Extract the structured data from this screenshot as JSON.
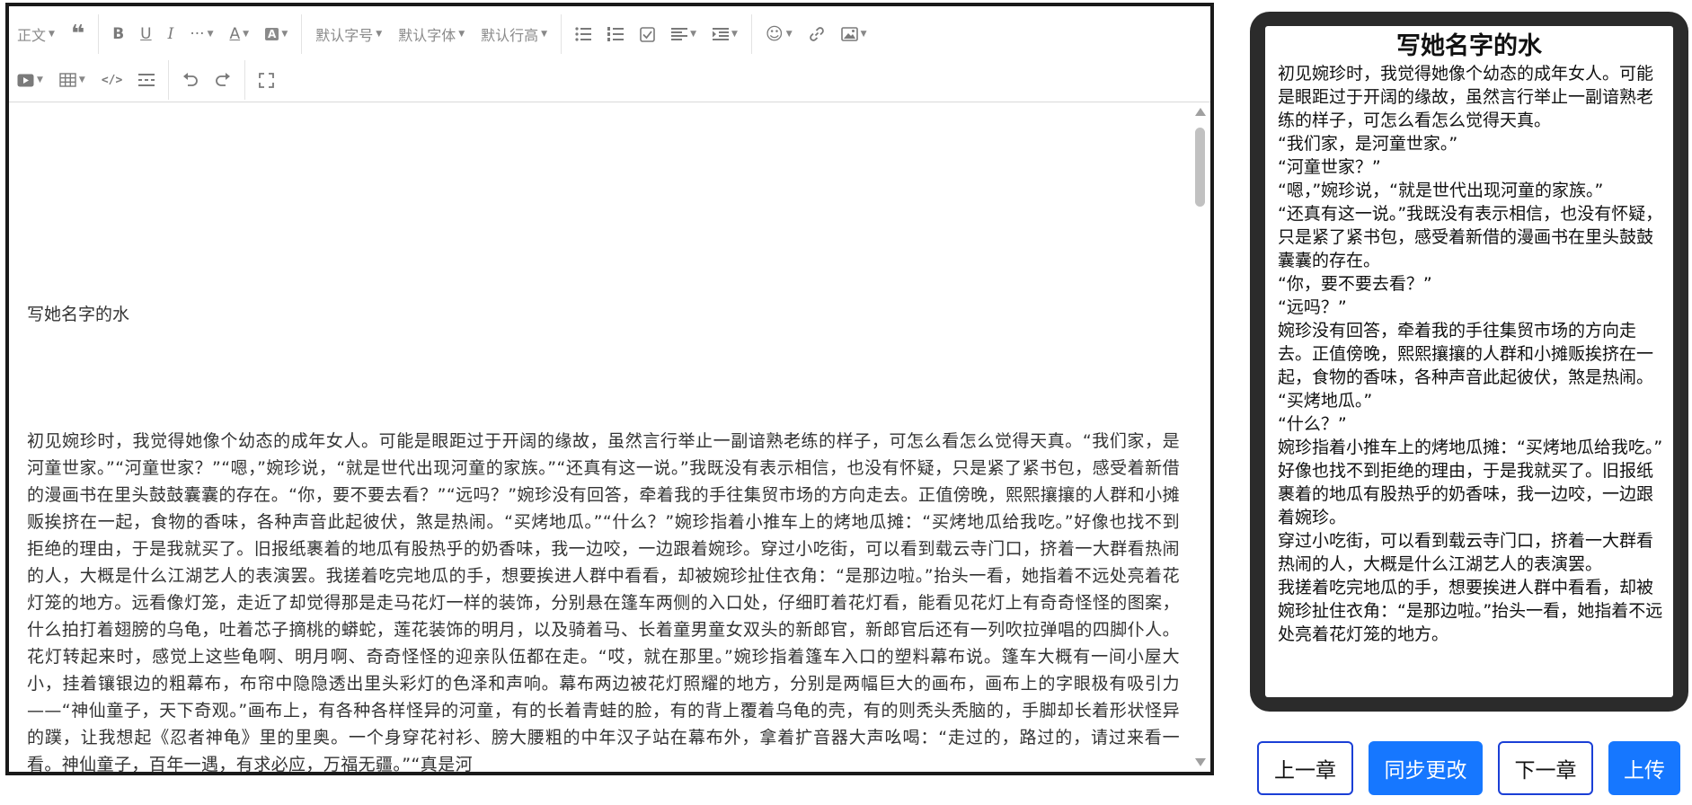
{
  "toolbar": {
    "paragraph": "正文",
    "font_size": "默认字号",
    "font_family": "默认字体",
    "line_height": "默认行高"
  },
  "doc": {
    "title": "写她名字的水",
    "body": "初见婉珍时，我觉得她像个幼态的成年女人。可能是眼距过于开阔的缘故，虽然言行举止一副谙熟老练的样子，可怎么看怎么觉得天真。“我们家，是河童世家。”“河童世家？”“嗯，”婉珍说，“就是世代出现河童的家族。”“还真有这一说。”我既没有表示相信，也没有怀疑，只是紧了紧书包，感受着新借的漫画书在里头鼓鼓囊囊的存在。“你，要不要去看？”“远吗？”婉珍没有回答，牵着我的手往集贸市场的方向走去。正值傍晚，熙熙攘攘的人群和小摊贩挨挤在一起，食物的香味，各种声音此起彼伏，煞是热闹。“买烤地瓜。”“什么？”婉珍指着小推车上的烤地瓜摊：“买烤地瓜给我吃。”好像也找不到拒绝的理由，于是我就买了。旧报纸裹着的地瓜有股热乎的奶香味，我一边咬，一边跟着婉珍。穿过小吃街，可以看到载云寺门口，挤着一大群看热闹的人，大概是什么江湖艺人的表演罢。我搓着吃完地瓜的手，想要挨进人群中看看，却被婉珍扯住衣角：“是那边啦。”抬头一看，她指着不远处亮着花灯笼的地方。远看像灯笼，走近了却觉得那是走马花灯一样的装饰，分别悬在篷车两侧的入口处，仔细盯着花灯看，能看见花灯上有奇奇怪怪的图案，什么拍打着翅膀的乌龟，吐着芯子摘桃的蟒蛇，莲花装饰的明月，以及骑着马、长着童男童女双头的新郎官，新郎官后还有一列吹拉弹唱的四脚仆人。花灯转起来时，感觉上这些龟啊、明月啊、奇奇怪怪的迎亲队伍都在走。“哎，就在那里。”婉珍指着篷车入口的塑料幕布说。篷车大概有一间小屋大小，挂着镶银边的粗幕布，布帘中隐隐透出里头彩灯的色泽和声响。幕布两边被花灯照耀的地方，分别是两幅巨大的画布，画布上的字眼极有吸引力——“神仙童子，天下奇观。”画布上，有各种各样怪异的河童，有的长着青蛙的脸，有的背上覆着乌龟的壳，有的则秃头秃脑的，手脚却长着形状怪异的蹼，让我想起《忍者神龟》里的里奥。一个身穿花衬衫、膀大腰粗的中年汉子站在幕布外，拿着扩音器大声吆喝：“走过的，路过的，请过来看一看。神仙童子，百年一遇，有求必应，万福无疆。”“真是河"
  },
  "preview": {
    "title": "写她名字的水",
    "paragraphs": [
      "初见婉珍时，我觉得她像个幼态的成年女人。可能是眼距过于开阔的缘故，虽然言行举止一副谙熟老练的样子，可怎么看怎么觉得天真。",
      "“我们家，是河童世家。”",
      "“河童世家？”",
      "“嗯，”婉珍说，“就是世代出现河童的家族。”",
      "“还真有这一说。”我既没有表示相信，也没有怀疑，只是紧了紧书包，感受着新借的漫画书在里头鼓鼓囊囊的存在。",
      "“你，要不要去看？”",
      "“远吗？”",
      "婉珍没有回答，牵着我的手往集贸市场的方向走去。正值傍晚，熙熙攘攘的人群和小摊贩挨挤在一起，食物的香味，各种声音此起彼伏，煞是热闹。",
      "“买烤地瓜。”",
      "“什么？”",
      "婉珍指着小推车上的烤地瓜摊：“买烤地瓜给我吃。”",
      "好像也找不到拒绝的理由，于是我就买了。旧报纸裹着的地瓜有股热乎的奶香味，我一边咬，一边跟着婉珍。",
      "穿过小吃街，可以看到载云寺门口，挤着一大群看热闹的人，大概是什么江湖艺人的表演罢。",
      "我搓着吃完地瓜的手，想要挨进人群中看看，却被婉珍扯住衣角：“是那边啦。”抬头一看，她指着不远处亮着花灯笼的地方。"
    ]
  },
  "buttons": {
    "prev": "上一章",
    "sync": "同步更改",
    "next": "下一章",
    "upload": "上传"
  },
  "colors": {
    "primary": "#1677ff",
    "outline_border": "#1a3fd6",
    "frame": "#2b2b2b"
  }
}
